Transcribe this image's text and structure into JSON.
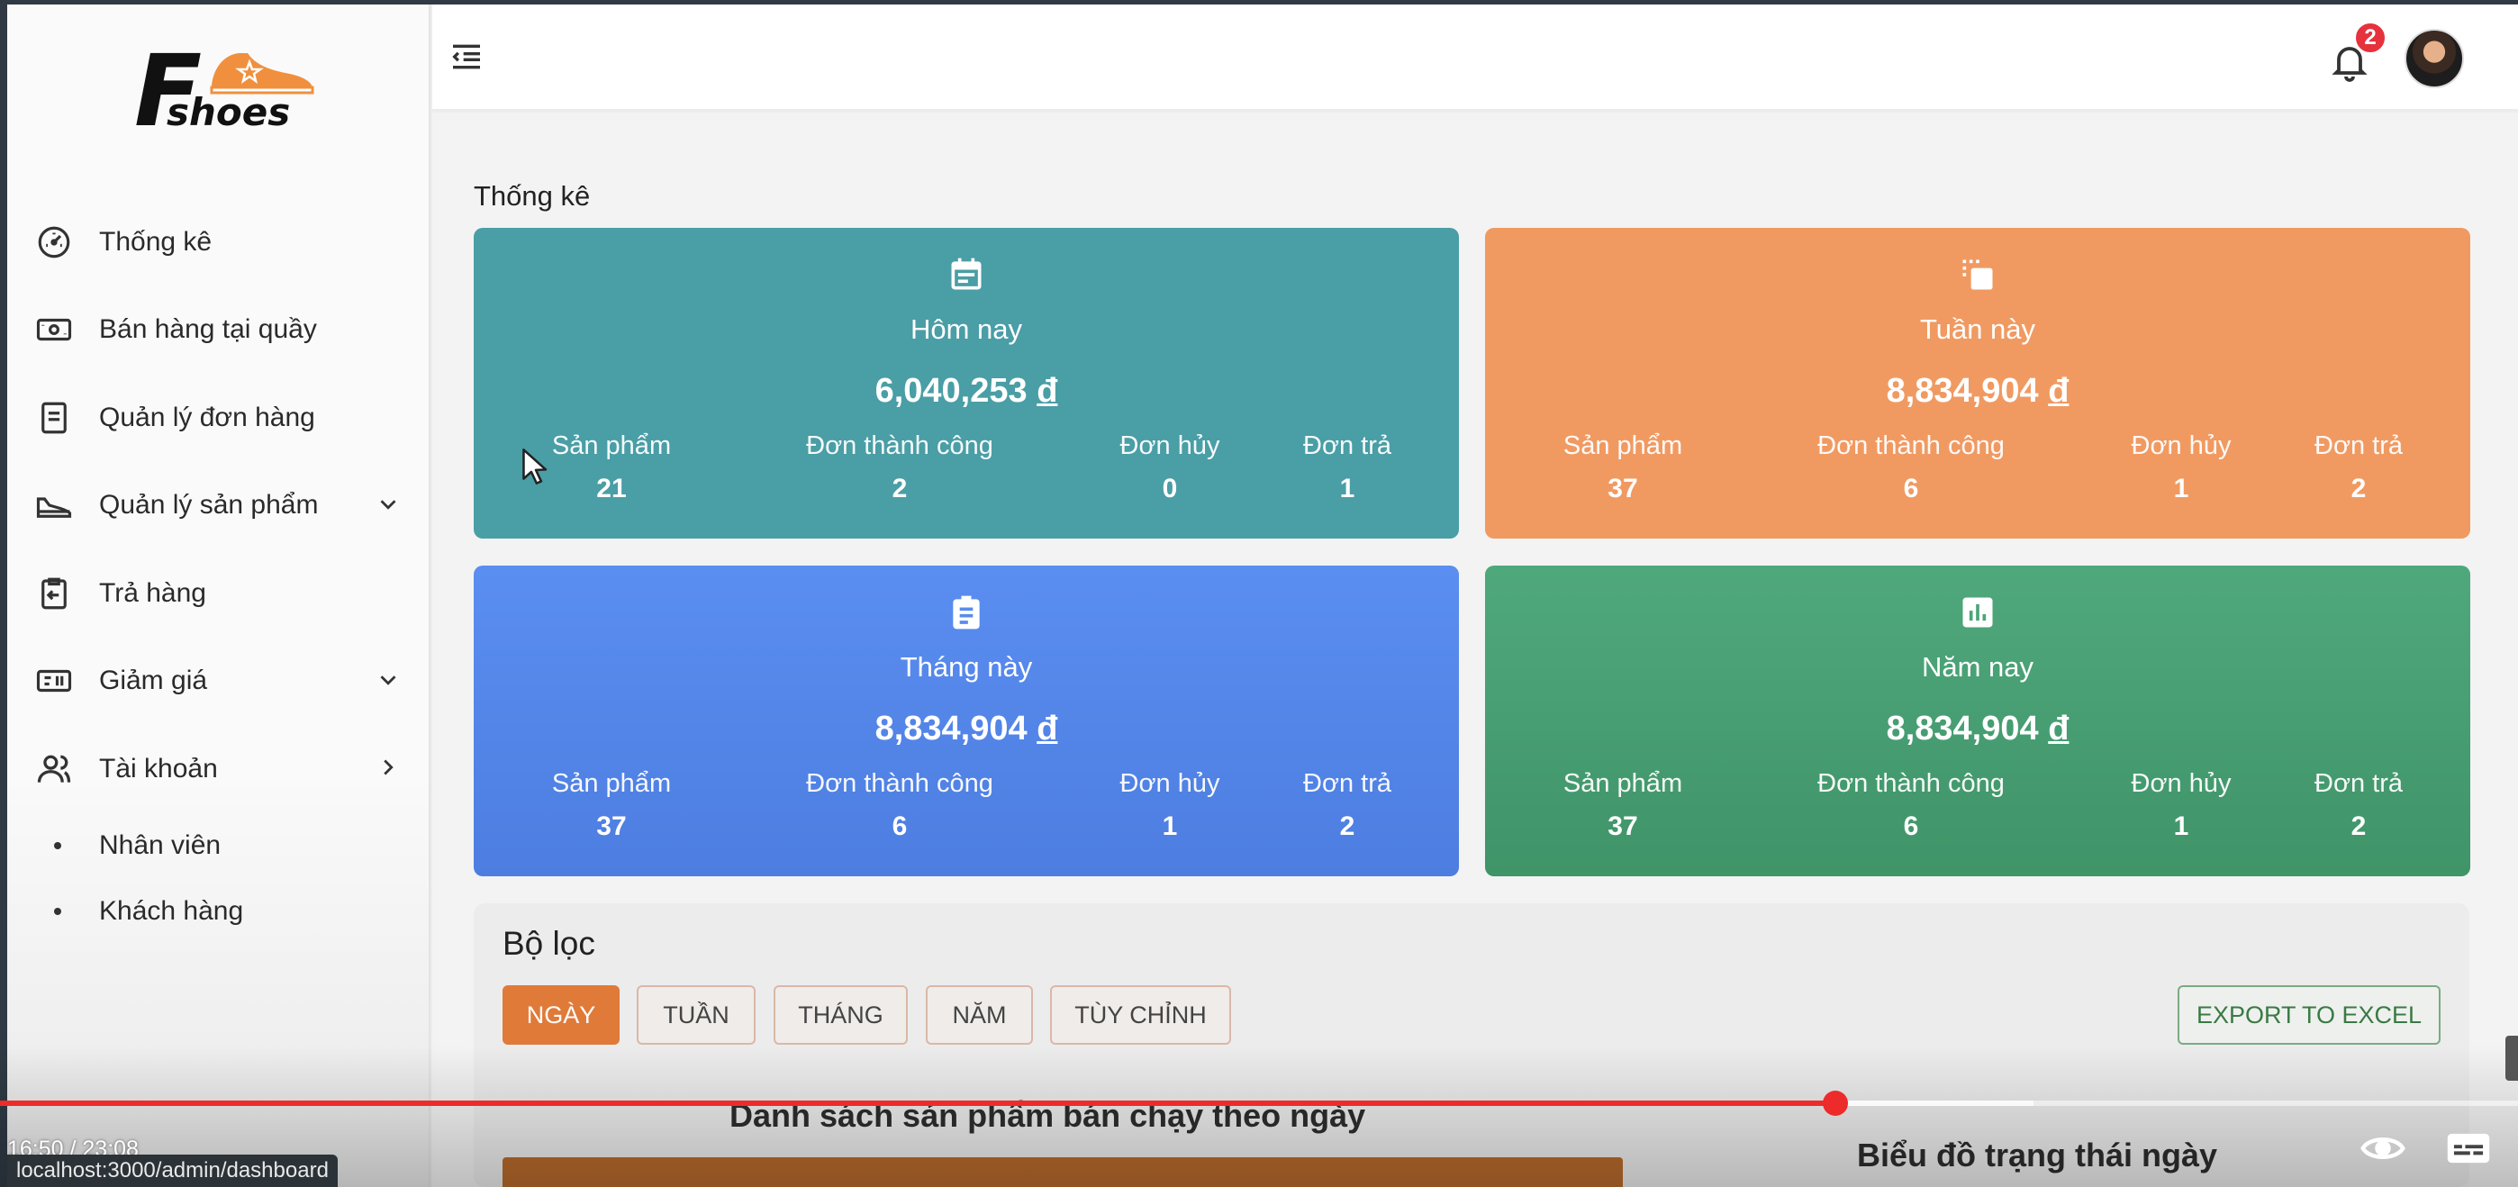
{
  "sidebar": {
    "logo_letter": "F",
    "logo_text": "shoes",
    "items": [
      {
        "label": "Thống kê",
        "icon": "gauge-icon"
      },
      {
        "label": "Bán hàng tại quầy",
        "icon": "cash-icon"
      },
      {
        "label": "Quản lý đơn hàng",
        "icon": "document-icon"
      },
      {
        "label": "Quản lý sản phẩm",
        "icon": "shoe-icon"
      },
      {
        "label": "Trả hàng",
        "icon": "return-icon"
      },
      {
        "label": "Giảm giá",
        "icon": "voucher-icon"
      },
      {
        "label": "Tài khoản",
        "icon": "users-icon"
      }
    ],
    "sub_items": [
      "Nhân viên",
      "Khách hàng"
    ]
  },
  "header": {
    "notification_count": "2"
  },
  "page": {
    "section_title": "Thống kê"
  },
  "cards": [
    {
      "title": "Hôm nay",
      "amount": "6,040,253",
      "currency": "đ",
      "icon": "calendar-icon",
      "color": "#4a9ea6",
      "stats": [
        {
          "label": "Sản phẩm",
          "value": "21"
        },
        {
          "label": "Đơn thành công",
          "value": "2"
        },
        {
          "label": "Đơn hủy",
          "value": "0"
        },
        {
          "label": "Đơn trả",
          "value": "1"
        }
      ]
    },
    {
      "title": "Tuần này",
      "amount": "8,834,904",
      "currency": "đ",
      "icon": "copy-icon",
      "color": "#f09a62",
      "stats": [
        {
          "label": "Sản phẩm",
          "value": "37"
        },
        {
          "label": "Đơn thành công",
          "value": "6"
        },
        {
          "label": "Đơn hủy",
          "value": "1"
        },
        {
          "label": "Đơn trả",
          "value": "2"
        }
      ]
    },
    {
      "title": "Tháng này",
      "amount": "8,834,904",
      "currency": "đ",
      "icon": "clipboard-icon",
      "color": "#5a8ef0",
      "stats": [
        {
          "label": "Sản phẩm",
          "value": "37"
        },
        {
          "label": "Đơn thành công",
          "value": "6"
        },
        {
          "label": "Đơn hủy",
          "value": "1"
        },
        {
          "label": "Đơn trả",
          "value": "2"
        }
      ]
    },
    {
      "title": "Năm nay",
      "amount": "8,834,904",
      "currency": "đ",
      "icon": "bar-chart-icon",
      "color": "#4fa87c",
      "stats": [
        {
          "label": "Sản phẩm",
          "value": "37"
        },
        {
          "label": "Đơn thành công",
          "value": "6"
        },
        {
          "label": "Đơn hủy",
          "value": "1"
        },
        {
          "label": "Đơn trả",
          "value": "2"
        }
      ]
    }
  ],
  "filter": {
    "title": "Bộ lọc",
    "buttons": [
      "NGÀY",
      "TUẦN",
      "THÁNG",
      "NĂM",
      "TÙY CHỈNH"
    ],
    "active": "NGÀY",
    "export_label": "EXPORT TO EXCEL",
    "list_title": "Danh sách sản phẩm bán chạy theo ngày",
    "chart_title": "Biểu đồ trạng thái ngày"
  },
  "video": {
    "time": "16:50 / 23:08",
    "played_fraction": 0.729,
    "status_url": "localhost:3000/admin/dashboard"
  },
  "colors": {
    "accent": "#e07a38",
    "progress": "#ee2b2b",
    "export": "#3a7a44"
  }
}
